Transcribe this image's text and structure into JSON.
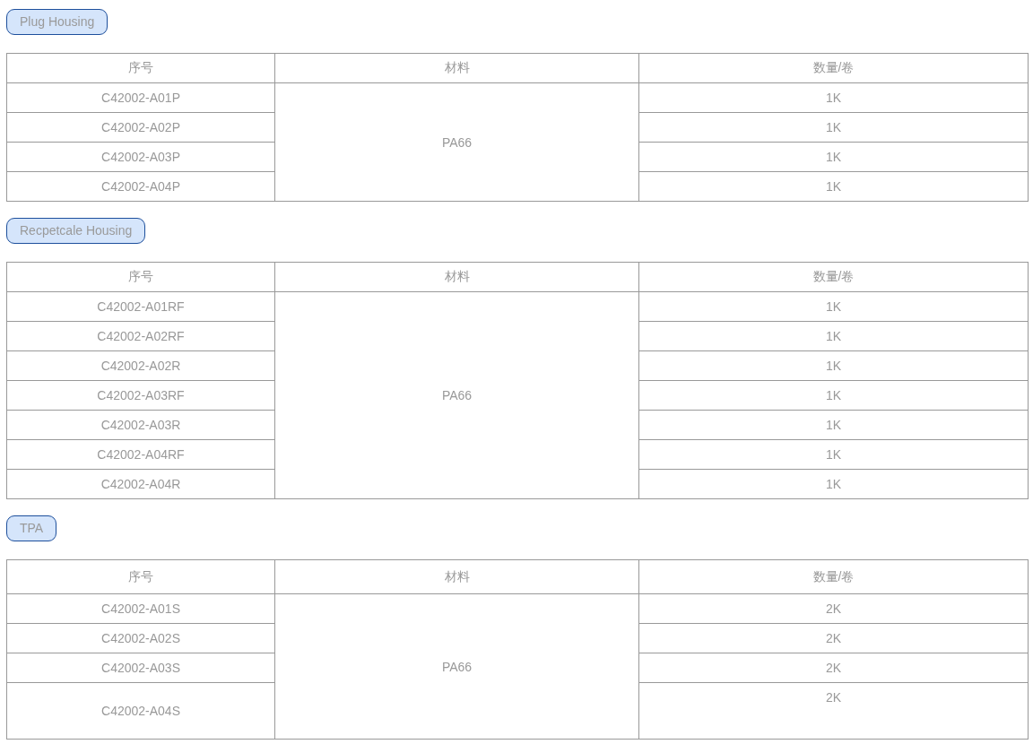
{
  "sections": [
    {
      "title": "Plug Housing",
      "columns": [
        "序号",
        "材料",
        "数量/卷"
      ],
      "material": "PA66",
      "rows": [
        {
          "part": "C42002-A01P",
          "qty": "1K"
        },
        {
          "part": "C42002-A02P",
          "qty": "1K"
        },
        {
          "part": "C42002-A03P",
          "qty": "1K"
        },
        {
          "part": "C42002-A04P",
          "qty": "1K"
        }
      ]
    },
    {
      "title": "Recpetcale Housing",
      "columns": [
        "序号",
        "材料",
        "数量/卷"
      ],
      "material": "PA66",
      "rows": [
        {
          "part": "C42002-A01RF",
          "qty": "1K"
        },
        {
          "part": "C42002-A02RF",
          "qty": "1K"
        },
        {
          "part": "C42002-A02R",
          "qty": "1K"
        },
        {
          "part": "C42002-A03RF",
          "qty": "1K"
        },
        {
          "part": "C42002-A03R",
          "qty": "1K"
        },
        {
          "part": "C42002-A04RF",
          "qty": "1K"
        },
        {
          "part": "C42002-A04R",
          "qty": "1K"
        }
      ]
    },
    {
      "title": "TPA",
      "columns": [
        "序号",
        "材料",
        "数量/卷"
      ],
      "material": "PA66",
      "rows": [
        {
          "part": "C42002-A01S",
          "qty": "2K"
        },
        {
          "part": "C42002-A02S",
          "qty": "2K"
        },
        {
          "part": "C42002-A03S",
          "qty": "2K"
        },
        {
          "part": "C42002-A04S",
          "qty": "2K"
        }
      ]
    }
  ]
}
